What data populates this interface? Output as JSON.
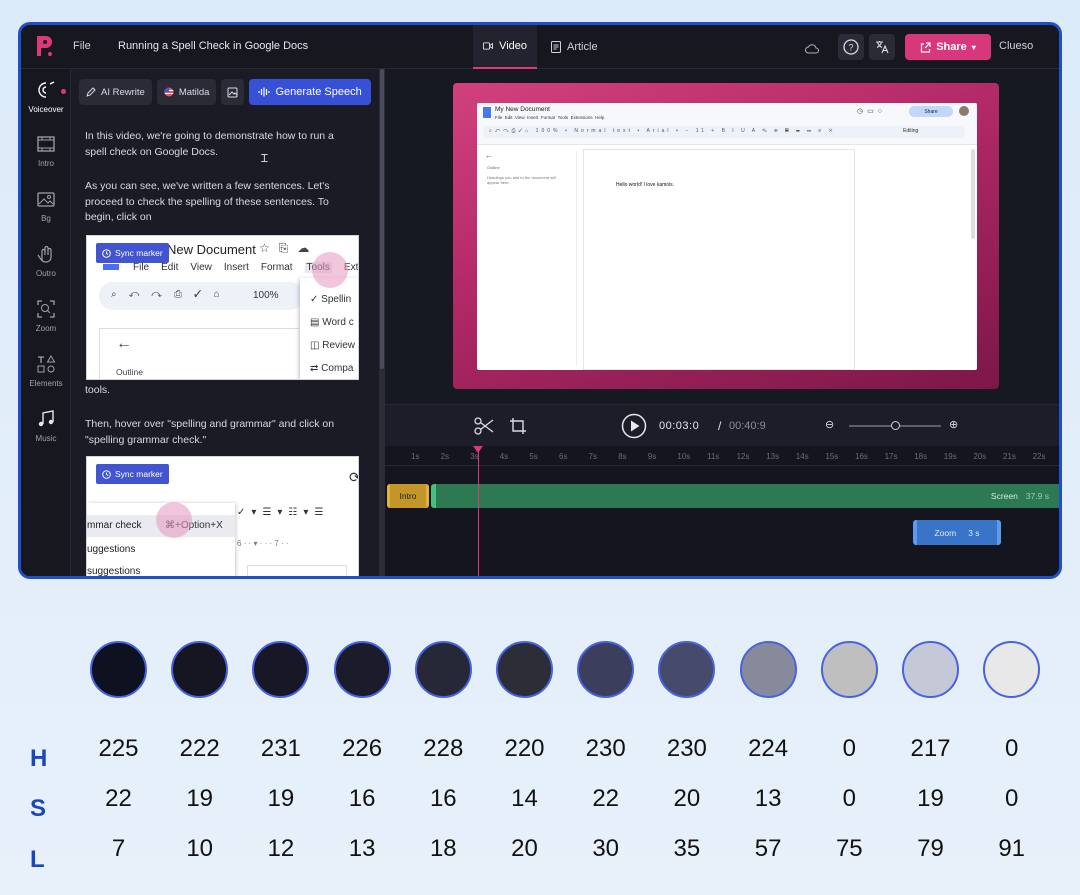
{
  "topbar": {
    "file_label": "File",
    "doc_title": "Running a Spell Check in Google Docs",
    "tab_video": "Video",
    "tab_article": "Article",
    "share_label": "Share",
    "user_name": "Clueso"
  },
  "sidebar": {
    "items": [
      {
        "label": "Voiceover",
        "icon": "voiceover-icon"
      },
      {
        "label": "Intro",
        "icon": "intro-icon"
      },
      {
        "label": "Bg",
        "icon": "background-icon"
      },
      {
        "label": "Outro",
        "icon": "outro-icon"
      },
      {
        "label": "Zoom",
        "icon": "zoom-icon"
      },
      {
        "label": "Elements",
        "icon": "elements-icon"
      },
      {
        "label": "Music",
        "icon": "music-icon"
      }
    ]
  },
  "editor": {
    "ai_rewrite": "AI Rewrite",
    "voice_name": "Matilda",
    "generate": "Generate Speech",
    "p1": "In this video, we're going to demonstrate how to run a spell check on Google Docs.",
    "p2": "As you can see, we've written a few sentences. Let's proceed to check the spelling of these sentences. To begin, click on",
    "p3": "tools.",
    "p4": "Then, hover over \"spelling and grammar\" and click on \"spelling grammar check.\"",
    "sync_marker": "Sync marker",
    "shot1": {
      "title": "New Document",
      "menus": [
        "File",
        "Edit",
        "View",
        "Insert",
        "Format",
        "Tools",
        "Exte"
      ],
      "zoom": "100%",
      "outline": "Outline",
      "tools_items": [
        "Spellin",
        "Word c",
        "Review",
        "Compa"
      ]
    },
    "shot2": {
      "row1": "mmar check",
      "shortcut": "⌘+Option+X",
      "row2": "uggestions",
      "row3": "suggestions"
    }
  },
  "preview": {
    "doc_title": "My New Document",
    "doc_menus": "File  Edit  View  Insert  Format  Tools  Extensions  Help",
    "doc_text": "Hello world! I love kamols.",
    "outline_hint": "Headings you add to the document will appear here.",
    "outline_label": "Outline",
    "share": "Share",
    "editing": "Editing"
  },
  "controls": {
    "current_time": "00:03:0",
    "separator": "/",
    "total_time": "00:40:9",
    "zoom_level": 0.5
  },
  "timeline": {
    "ticks": [
      "1s",
      "2s",
      "3s",
      "4s",
      "5s",
      "6s",
      "7s",
      "8s",
      "9s",
      "10s",
      "11s",
      "12s",
      "13s",
      "14s",
      "15s",
      "16s",
      "17s",
      "18s",
      "19s",
      "20s",
      "21s",
      "22s"
    ],
    "intro_label": "Intro",
    "screen_label": "Screen",
    "screen_duration": "37.9 s",
    "zoom_label": "Zoom",
    "zoom_duration": "3 s"
  },
  "palette": {
    "swatches": [
      {
        "color": "#0e1220",
        "h": "225",
        "s": "22",
        "l": "7"
      },
      {
        "color": "#151621",
        "h": "222",
        "s": "19",
        "l": "10"
      },
      {
        "color": "#181727",
        "h": "231",
        "s": "19",
        "l": "12"
      },
      {
        "color": "#1c1b2b",
        "h": "226",
        "s": "16",
        "l": "13"
      },
      {
        "color": "#262837",
        "h": "228",
        "s": "16",
        "l": "18"
      },
      {
        "color": "#2c2d37",
        "h": "220",
        "s": "14",
        "l": "20"
      },
      {
        "color": "#3b3e5d",
        "h": "230",
        "s": "22",
        "l": "30"
      },
      {
        "color": "#474b6b",
        "h": "230",
        "s": "20",
        "l": "35"
      },
      {
        "color": "#868a9b",
        "h": "224",
        "s": "13",
        "l": "57"
      },
      {
        "color": "#bfbfbf",
        "h": "0",
        "s": "0",
        "l": "75"
      },
      {
        "color": "#c5c9d7",
        "h": "217",
        "s": "19",
        "l": "79"
      },
      {
        "color": "#e8e8e8",
        "h": "0",
        "s": "0",
        "l": "91"
      }
    ],
    "label_h": "H",
    "label_s": "S",
    "label_l": "L"
  }
}
